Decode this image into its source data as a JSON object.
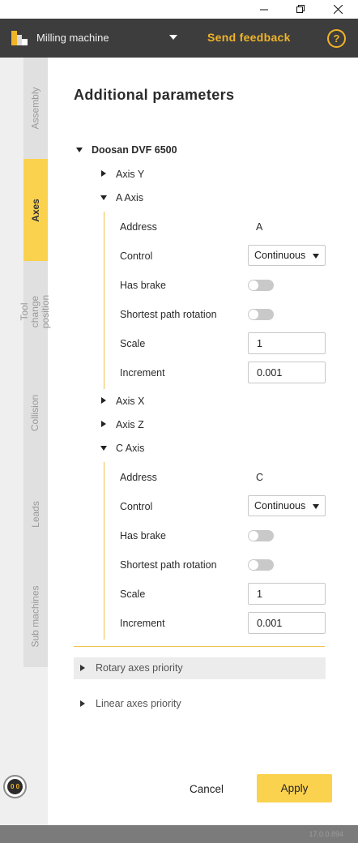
{
  "app": {
    "machine_selector": "Milling machine",
    "send_feedback": "Send feedback",
    "help": "?",
    "version": "17.0.0.894",
    "brand_color": "#f0b429"
  },
  "sidebar": {
    "tabs": [
      {
        "label": "Assembly",
        "active": false
      },
      {
        "label": "Axes",
        "active": true
      },
      {
        "label": "Tool change position",
        "active": false
      },
      {
        "label": "Collision",
        "active": false
      },
      {
        "label": "Leads",
        "active": false
      },
      {
        "label": "Sub machines",
        "active": false
      }
    ],
    "robot_eyes": "0 0"
  },
  "main": {
    "title": "Additional parameters",
    "machine": "Doosan DVF 6500",
    "axes": [
      {
        "label": "Axis Y",
        "expanded": false
      },
      {
        "label": "A Axis",
        "expanded": true,
        "rows": {
          "address_label": "Address",
          "address_value": "A",
          "control_label": "Control",
          "control_value": "Continuous",
          "brake_label": "Has brake",
          "brake_on": false,
          "shortest_label": "Shortest path rotation",
          "shortest_on": false,
          "scale_label": "Scale",
          "scale_value": "1",
          "increment_label": "Increment",
          "increment_value": "0.001"
        }
      },
      {
        "label": "Axis X",
        "expanded": false
      },
      {
        "label": "Axis Z",
        "expanded": false
      },
      {
        "label": "C Axis",
        "expanded": true,
        "rows": {
          "address_label": "Address",
          "address_value": "C",
          "control_label": "Control",
          "control_value": "Continuous",
          "brake_label": "Has brake",
          "brake_on": false,
          "shortest_label": "Shortest path rotation",
          "shortest_on": false,
          "scale_label": "Scale",
          "scale_value": "1",
          "increment_label": "Increment",
          "increment_value": "0.001"
        }
      }
    ],
    "sections": [
      {
        "label": "Rotary axes priority",
        "expanded": false
      },
      {
        "label": "Linear axes priority",
        "expanded": false
      }
    ]
  },
  "footer": {
    "cancel": "Cancel",
    "apply": "Apply"
  }
}
